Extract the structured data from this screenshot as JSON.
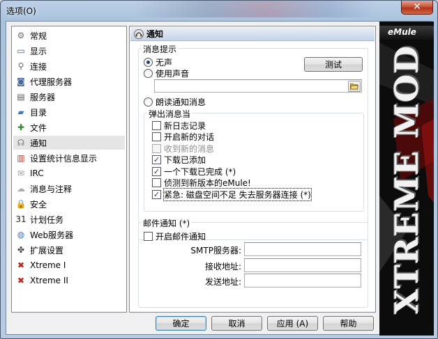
{
  "window": {
    "title": "选项(O)",
    "close_glyph": "✕"
  },
  "sidebar": {
    "items": [
      {
        "label": "常规",
        "icon": "gear-icon",
        "glyph": "⚙",
        "color": "#707070"
      },
      {
        "label": "显示",
        "icon": "monitor-icon",
        "glyph": "▭",
        "color": "#3a5a8a"
      },
      {
        "label": "连接",
        "icon": "connection-icon",
        "glyph": "⚲",
        "color": "#666"
      },
      {
        "label": "代理服务器",
        "icon": "proxy-icon",
        "glyph": "◙",
        "color": "#4a6aa0"
      },
      {
        "label": "服务器",
        "icon": "server-icon",
        "glyph": "▤",
        "color": "#555"
      },
      {
        "label": "目录",
        "icon": "folder-icon",
        "glyph": "▰",
        "color": "#3b79c9"
      },
      {
        "label": "文件",
        "icon": "file-icon",
        "glyph": "✚",
        "color": "#2a8a2a"
      },
      {
        "label": "通知",
        "icon": "notification-icon",
        "glyph": "☊",
        "color": "#777",
        "selected": true
      },
      {
        "label": "设置统计信息显示",
        "icon": "statistics-icon",
        "glyph": "▥",
        "color": "#c23a2a"
      },
      {
        "label": "IRC",
        "icon": "irc-icon",
        "glyph": "✉",
        "color": "#999"
      },
      {
        "label": "消息与注释",
        "icon": "messages-icon",
        "glyph": "☁",
        "color": "#aaa"
      },
      {
        "label": "安全",
        "icon": "lock-icon",
        "glyph": "🔒",
        "color": "#d4a017"
      },
      {
        "label": "计划任务",
        "icon": "calendar-icon",
        "glyph": "31",
        "color": "#222"
      },
      {
        "label": "Web服务器",
        "icon": "web-server-icon",
        "glyph": "◍",
        "color": "#3a7ab8"
      },
      {
        "label": "扩展设置",
        "icon": "extended-settings-icon",
        "glyph": "✤",
        "color": "#444"
      },
      {
        "label": "Xtreme I",
        "icon": "xtreme-icon",
        "glyph": "✖",
        "color": "#c0211a"
      },
      {
        "label": "Xtreme II",
        "icon": "xtreme-icon",
        "glyph": "✖",
        "color": "#c0211a"
      }
    ]
  },
  "page": {
    "title": "通知",
    "message_prompt": {
      "legend": "消息提示",
      "radio_silent": "无声",
      "radio_sound": "使用声音",
      "test_button": "测试",
      "sound_path": "",
      "radio_speech": "朗读通知消息"
    },
    "popup": {
      "legend": "弹出消息当",
      "items": [
        {
          "label": "新日志记录",
          "checked": false,
          "disabled": false
        },
        {
          "label": "开启新的对话",
          "checked": false,
          "disabled": false
        },
        {
          "label": "收到新的消息",
          "checked": false,
          "disabled": true
        },
        {
          "label": "下载已添加",
          "checked": true,
          "disabled": false
        },
        {
          "label": "一个下载已完成 (*)",
          "checked": true,
          "disabled": false
        },
        {
          "label": "侦测到新版本的eMule!",
          "checked": false,
          "disabled": false
        },
        {
          "label": "紧急: 磁盘空间不足 失去服务器连接 (*)",
          "checked": true,
          "disabled": false,
          "focused": true
        }
      ]
    },
    "mail": {
      "legend": "邮件通知 (*)",
      "enable_label": "开启邮件通知",
      "smtp_label": "SMTP服务器:",
      "smtp_value": "",
      "recipient_label": "接收地址:",
      "recipient_value": "",
      "sender_label": "发送地址:",
      "sender_value": ""
    }
  },
  "buttons": {
    "ok": "确定",
    "cancel": "取消",
    "apply": "应用 (A)",
    "help": "帮助"
  },
  "banner": {
    "brand": "eMule",
    "mod_text": "XTREME MOD"
  }
}
